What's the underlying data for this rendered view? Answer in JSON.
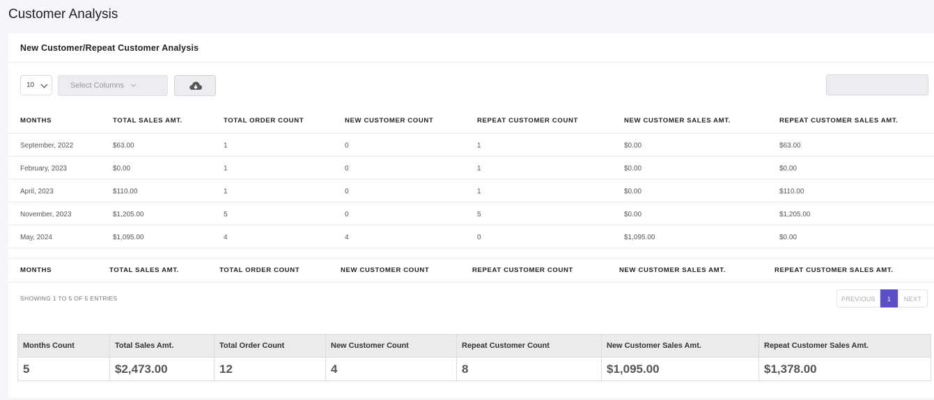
{
  "page": {
    "title": "Customer Analysis"
  },
  "card": {
    "title": "New Customer/Repeat Customer Analysis"
  },
  "toolbar": {
    "page_length": "10",
    "columns_placeholder": "Select Columns",
    "download_icon": "cloud-download-icon",
    "search_value": ""
  },
  "table": {
    "columns": [
      "MONTHS",
      "TOTAL SALES AMT.",
      "TOTAL ORDER COUNT",
      "NEW CUSTOMER COUNT",
      "REPEAT CUSTOMER COUNT",
      "NEW CUSTOMER SALES AMT.",
      "REPEAT CUSTOMER SALES AMT."
    ],
    "rows": [
      [
        "September, 2022",
        "$63.00",
        "1",
        "0",
        "1",
        "$0.00",
        "$63.00"
      ],
      [
        "February, 2023",
        "$0.00",
        "1",
        "0",
        "1",
        "$0.00",
        "$0.00"
      ],
      [
        "April, 2023",
        "$110.00",
        "1",
        "0",
        "1",
        "$0.00",
        "$110.00"
      ],
      [
        "November, 2023",
        "$1,205.00",
        "5",
        "0",
        "5",
        "$0.00",
        "$1,205.00"
      ],
      [
        "May, 2024",
        "$1,095.00",
        "4",
        "4",
        "0",
        "$1,095.00",
        "$0.00"
      ]
    ]
  },
  "info": "SHOWING 1 TO 5 OF 5 ENTRIES",
  "pagination": {
    "previous": "PREVIOUS",
    "current": "1",
    "next": "NEXT"
  },
  "summary": {
    "headers": [
      "Months Count",
      "Total Sales Amt.",
      "Total Order Count",
      "New Customer Count",
      "Repeat Customer Count",
      "New Customer Sales Amt.",
      "Repeat Customer Sales Amt."
    ],
    "values": [
      "5",
      "$2,473.00",
      "12",
      "4",
      "8",
      "$1,095.00",
      "$1,378.00"
    ]
  },
  "colors": {
    "accent": "#5a4fc8",
    "background": "#f6f5fb"
  }
}
